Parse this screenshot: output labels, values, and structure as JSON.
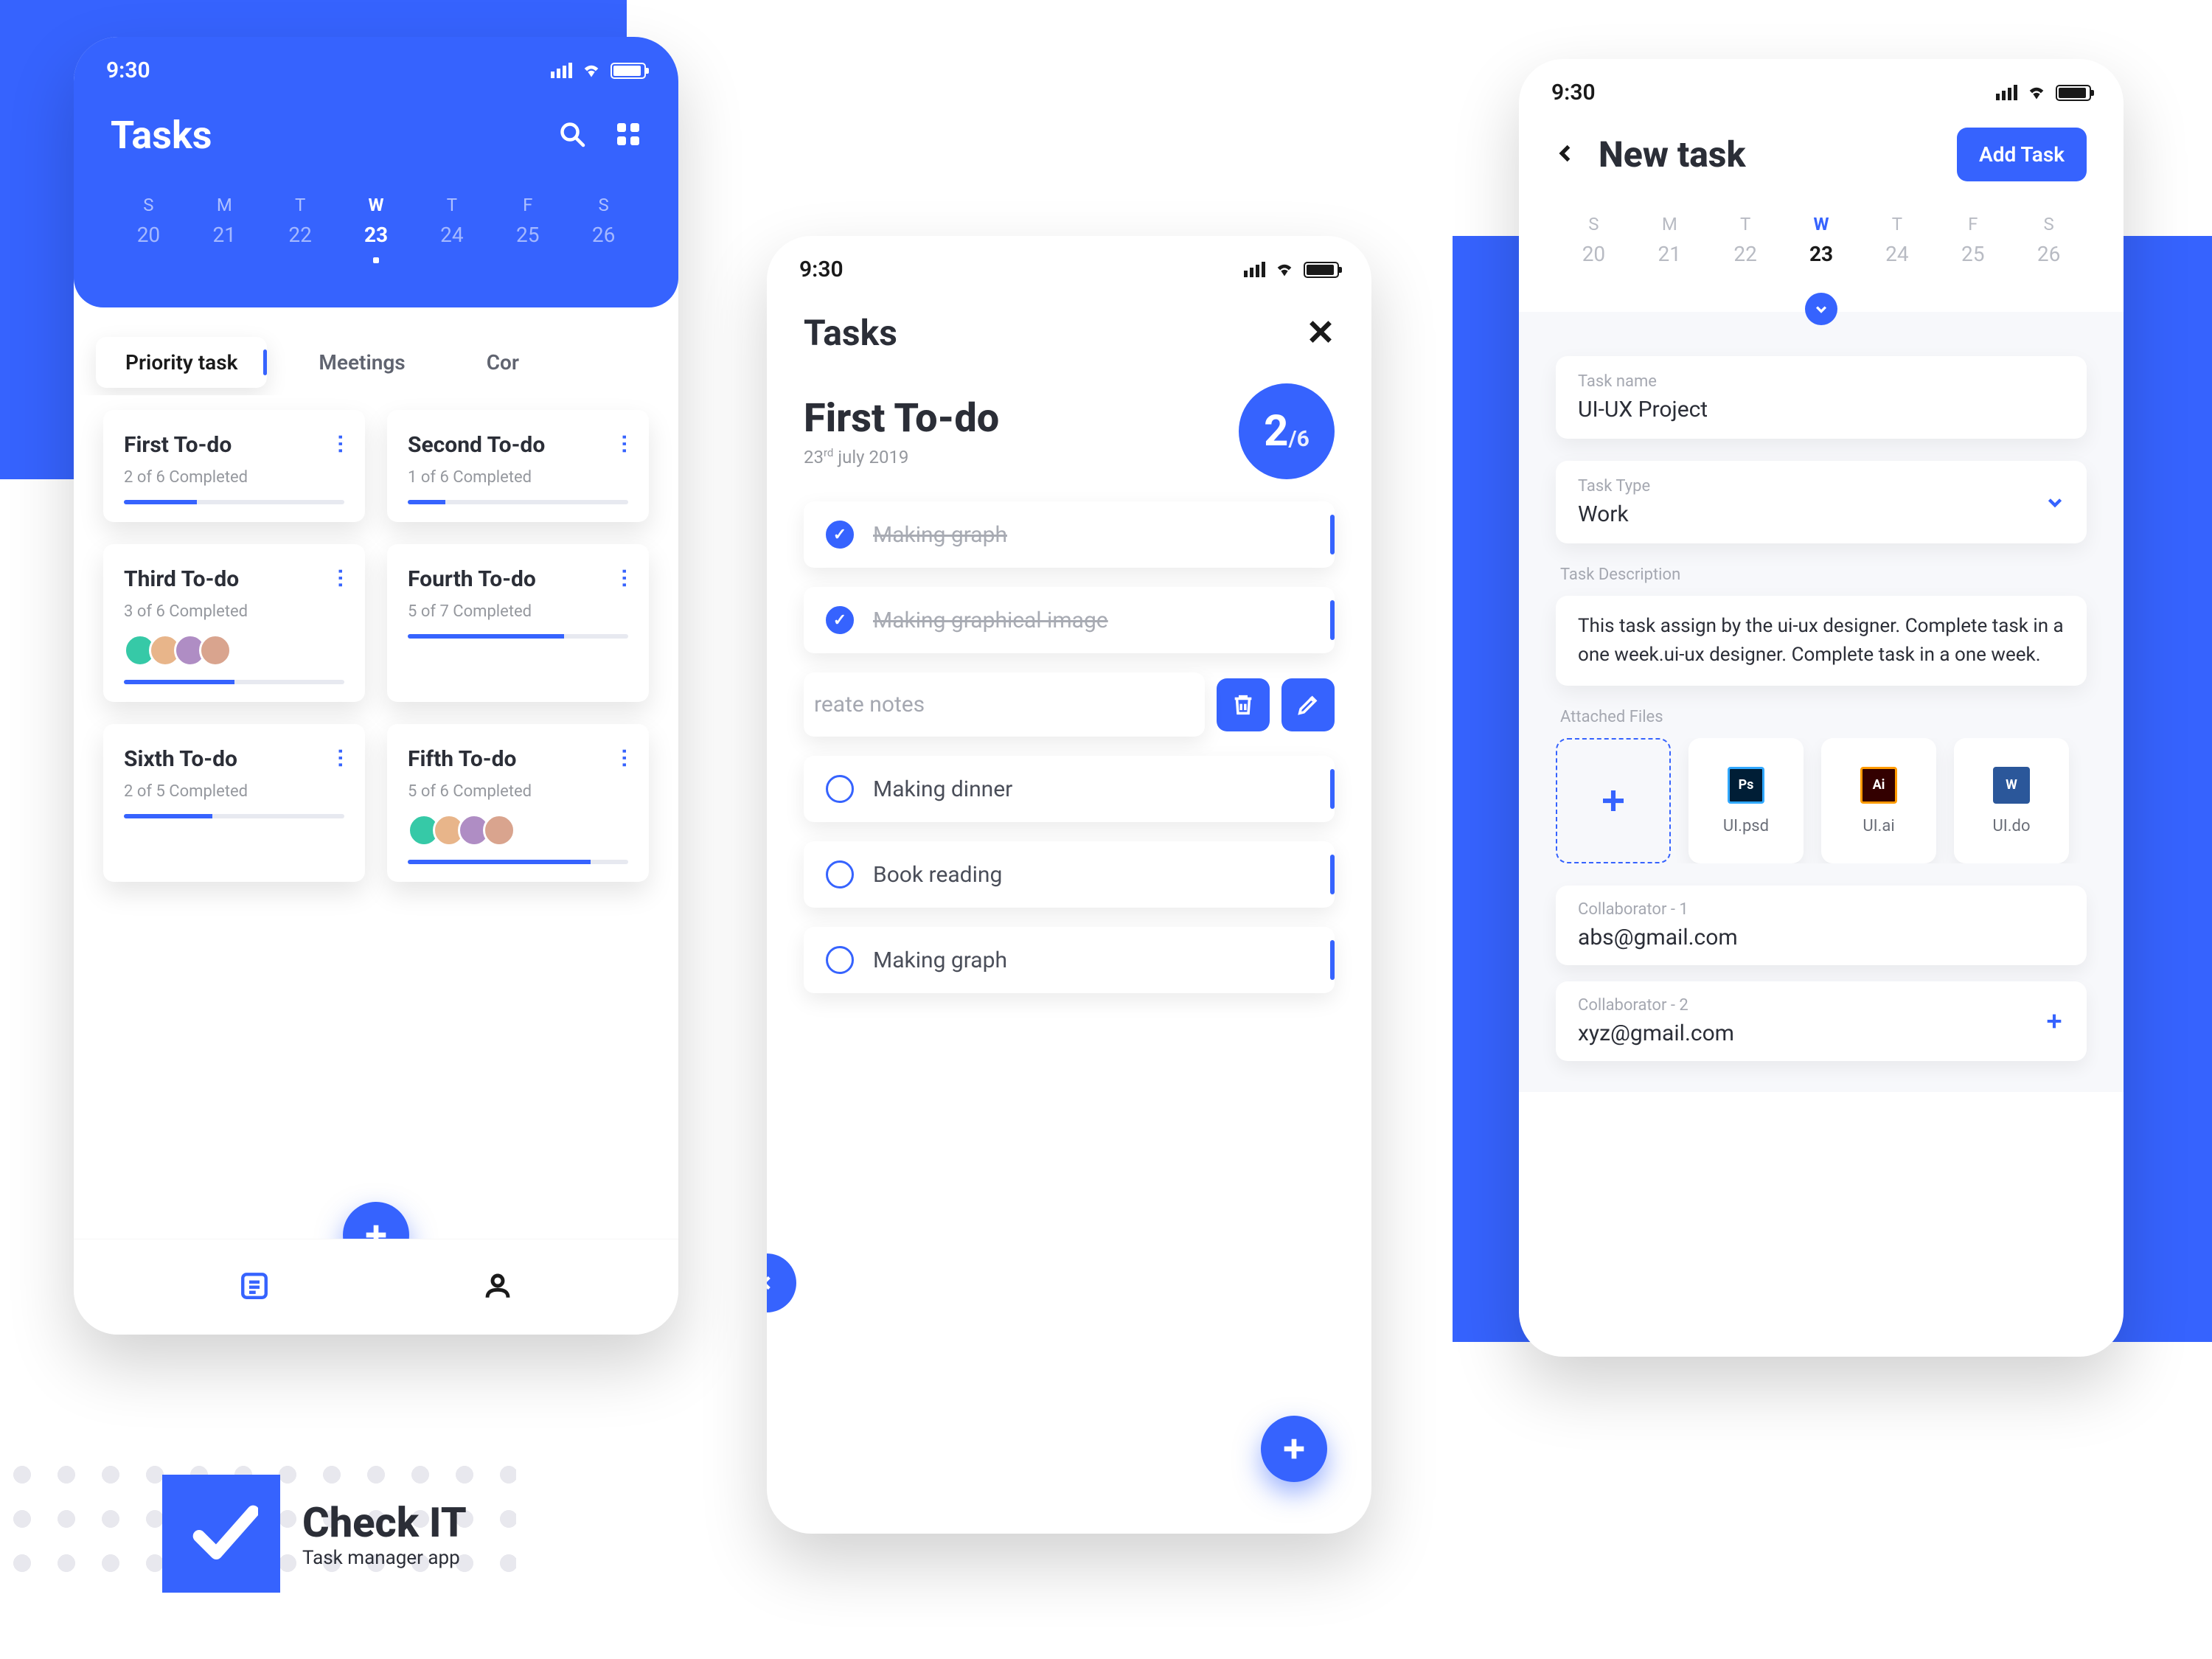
{
  "statusbar": {
    "time": "9:30"
  },
  "week": {
    "days": [
      "S",
      "M",
      "T",
      "W",
      "T",
      "F",
      "S"
    ],
    "dates": [
      "20",
      "21",
      "22",
      "23",
      "24",
      "25",
      "26"
    ],
    "selected": 3
  },
  "screen1": {
    "title": "Tasks",
    "tabs": [
      "Priority task",
      "Meetings",
      "Cor"
    ],
    "activeTab": 0,
    "cards": [
      {
        "title": "First To-do",
        "sub": "2 of 6 Completed",
        "progress": 33,
        "avatars": 0
      },
      {
        "title": "Second To-do",
        "sub": "1 of 6 Completed",
        "progress": 17,
        "avatars": 0
      },
      {
        "title": "Third To-do",
        "sub": "3 of 6 Completed",
        "progress": 50,
        "avatars": 4
      },
      {
        "title": "Fourth To-do",
        "sub": "5 of 7 Completed",
        "progress": 71,
        "avatars": 0
      },
      {
        "title": "Sixth To-do",
        "sub": "2 of 5 Completed",
        "progress": 40,
        "avatars": 0
      },
      {
        "title": "Fifth To-do",
        "sub": "5 of 6 Completed",
        "progress": 83,
        "avatars": 4
      }
    ]
  },
  "screen2": {
    "title": "Tasks",
    "detailTitle": "First To-do",
    "detailDatePre": "23",
    "detailDateSup": "rd",
    "detailDatePost": " july 2019",
    "countDone": "2",
    "countTotal": "/6",
    "tasks": [
      {
        "label": "Making graph",
        "done": true
      },
      {
        "label": "Making graphical image",
        "done": true
      }
    ],
    "swipeTask": "reate notes",
    "pending": [
      {
        "label": "Making dinner"
      },
      {
        "label": "Book reading"
      },
      {
        "label": "Making graph"
      }
    ]
  },
  "screen3": {
    "title": "New task",
    "addBtn": "Add Task",
    "fields": {
      "nameLabel": "Task name",
      "nameVal": "UI-UX Project",
      "typeLabel": "Task Type",
      "typeVal": "Work",
      "descLabel": "Task Description",
      "descVal": "This task assign by the ui-ux designer. Complete task in a one week.ui-ux designer. Complete task in a one week.",
      "filesLabel": "Attached Files"
    },
    "files": [
      {
        "name": "UI.psd",
        "icon": "Ps",
        "bg": "#001E36",
        "border": "#31A8FF"
      },
      {
        "name": "UI.ai",
        "icon": "Ai",
        "bg": "#330000",
        "border": "#FF9A00"
      },
      {
        "name": "UI.do",
        "icon": "W",
        "bg": "#2B579A",
        "border": "#2B579A"
      }
    ],
    "collab": [
      {
        "label": "Collaborator - 1",
        "email": "abs@gmail.com",
        "add": false
      },
      {
        "label": "Collaborator - 2",
        "email": "xyz@gmail.com",
        "add": true
      }
    ]
  },
  "brand": {
    "name": "Check IT",
    "sub": "Task manager app"
  },
  "avatarColors": [
    "#36C9A7",
    "#E8B58A",
    "#AF8DC4",
    "#D9A48E"
  ]
}
